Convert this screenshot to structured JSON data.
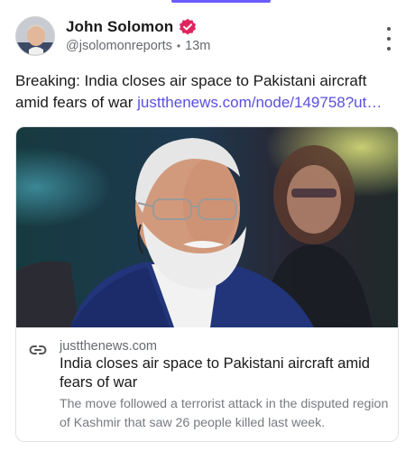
{
  "post": {
    "author": {
      "display_name": "John Solomon",
      "verified": true,
      "handle": "@jsolomonreports",
      "time": "13m",
      "separator": "•"
    },
    "menu_icon": "more-vertical-icon",
    "text": "Breaking: India closes air space to Pakistani aircraft amid fears of war",
    "link_text": "justthenews.com/node/149758?ut…"
  },
  "link_card": {
    "image_alt": "Photo of a man with white hair and beard wearing glasses and a blue vest",
    "domain": "justthenews.com",
    "title": "India closes air space to Pakistani aircraft amid fears of war",
    "description": "The move followed a terrorist attack in the disputed region of Kashmir that saw 26 people killed last week."
  },
  "colors": {
    "accent": "#6b5cff",
    "link": "#5a4fe0",
    "verified_badge": "#e0245e",
    "muted_text": "#666a70"
  }
}
